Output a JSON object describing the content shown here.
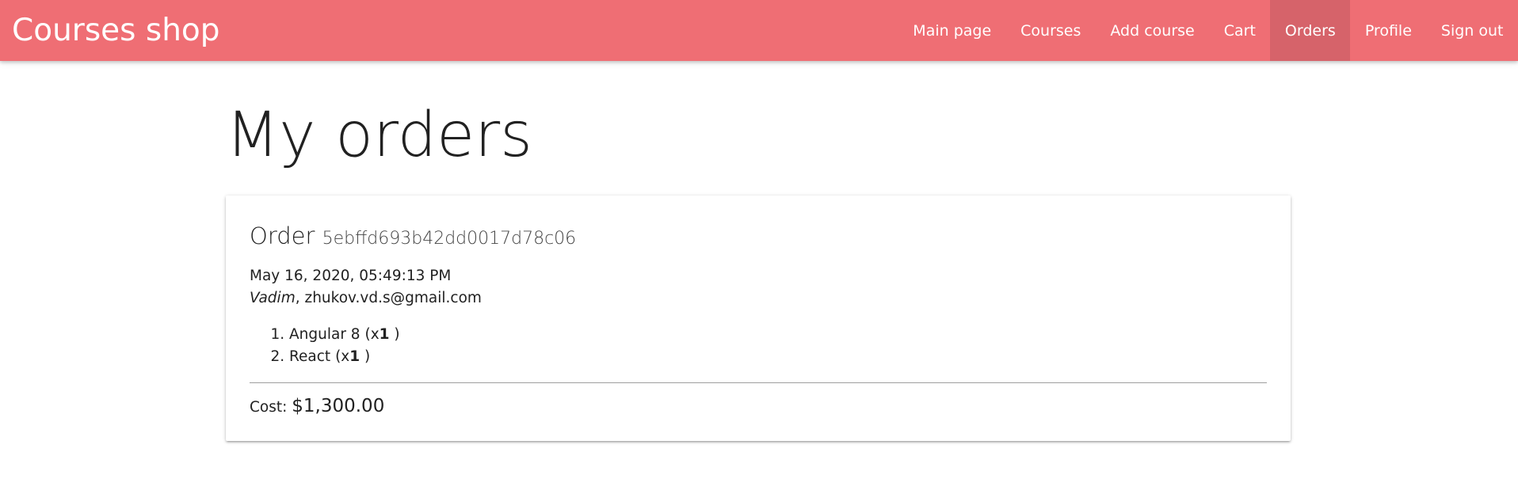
{
  "app": {
    "brand": "Courses shop"
  },
  "nav": {
    "items": [
      {
        "label": "Main page"
      },
      {
        "label": "Courses"
      },
      {
        "label": "Add course"
      },
      {
        "label": "Cart"
      },
      {
        "label": "Orders",
        "active": true
      },
      {
        "label": "Profile"
      },
      {
        "label": "Sign out"
      }
    ]
  },
  "page": {
    "title": "My orders"
  },
  "order": {
    "title_label": "Order",
    "id": "5ebffd693b42dd0017d78c06",
    "date": "May 16, 2020, 05:49:13 PM",
    "user_name": "Vadim",
    "user_separator": ",",
    "user_email": "zhukov.vd.s@gmail.com",
    "items": [
      {
        "title": "Angular 8",
        "qty_prefix": "(x",
        "qty": "1",
        "qty_suffix": " )"
      },
      {
        "title": "React",
        "qty_prefix": "(x",
        "qty": "1",
        "qty_suffix": " )"
      }
    ],
    "cost_label": "Cost:",
    "cost_value": "$1,300.00"
  },
  "colors": {
    "navbar": "#ef6e74",
    "nav_active": "#d6636a"
  }
}
